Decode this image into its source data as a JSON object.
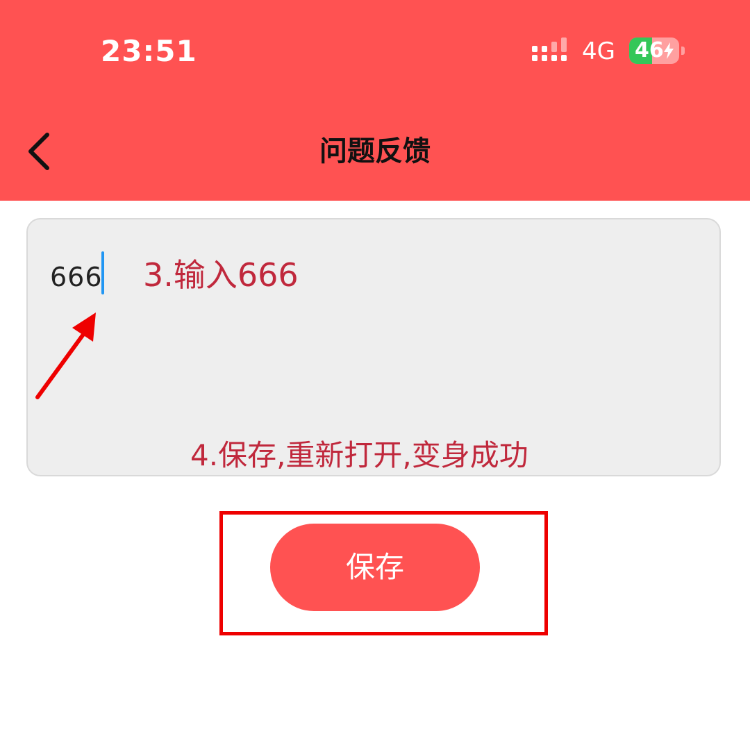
{
  "status_bar": {
    "time": "23:51",
    "network": "4G",
    "battery_level": "46",
    "battery_fraction": 0.46,
    "charging": true
  },
  "nav": {
    "title": "问题反馈",
    "back_icon": "chevron-left-icon"
  },
  "feedback": {
    "value": "666",
    "cursor_visible": true
  },
  "annotations": {
    "step3": "3.输入666",
    "step4": "4.保存,重新打开,变身成功"
  },
  "actions": {
    "save_label": "保存"
  },
  "colors": {
    "brand": "#ff5252",
    "annotation_text": "#c0283c",
    "annotation_box": "#ee0000",
    "caret": "#2196f3",
    "battery": "#34c759"
  }
}
